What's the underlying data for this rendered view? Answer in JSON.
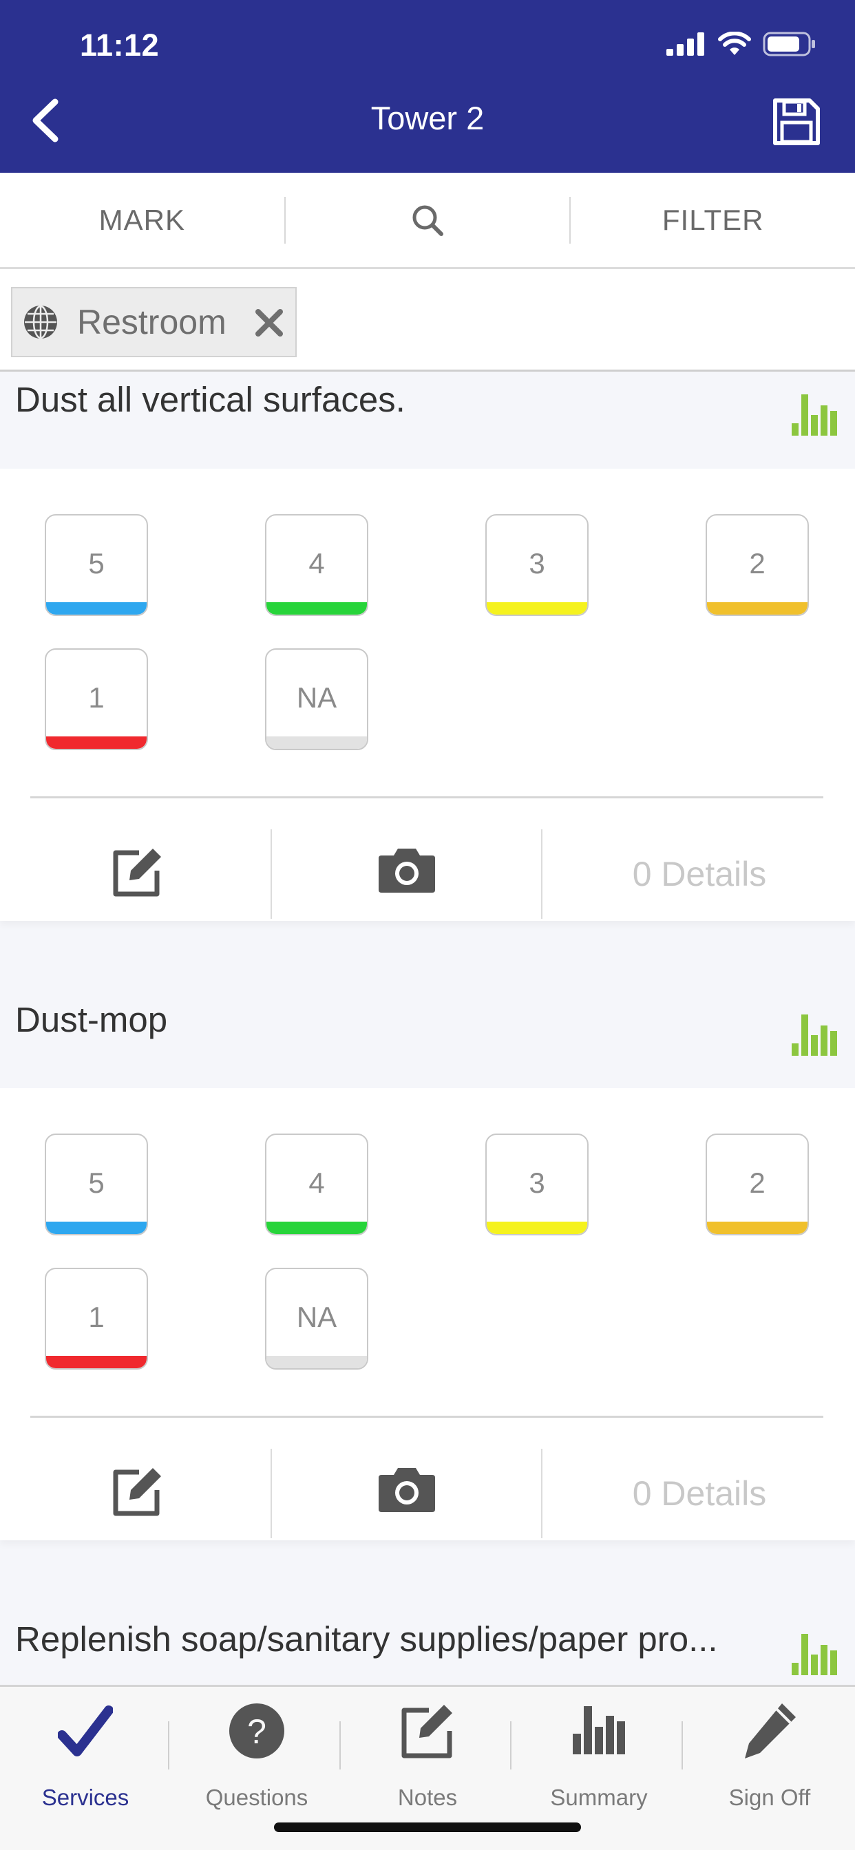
{
  "status_bar": {
    "time": "11:12"
  },
  "header": {
    "title": "Tower 2",
    "back_icon": "chevron-left-icon",
    "save_icon": "floppy-disk-icon"
  },
  "toolbar": {
    "mark_label": "MARK",
    "search_icon": "search-icon",
    "filter_label": "FILTER"
  },
  "filter_chip": {
    "label": "Restroom",
    "icon": "globe-icon",
    "close_icon": "close-icon"
  },
  "rating_scale": [
    {
      "label": "5",
      "color": "#2ea7ef"
    },
    {
      "label": "4",
      "color": "#27d43a"
    },
    {
      "label": "3",
      "color": "#f5f21e"
    },
    {
      "label": "2",
      "color": "#f0c02c"
    },
    {
      "label": "1",
      "color": "#f0292e"
    },
    {
      "label": "NA",
      "color": "#e2e2e2"
    }
  ],
  "tasks": [
    {
      "title": "Dust all vertical surfaces.",
      "details": "0 Details"
    },
    {
      "title": "Dust-mop",
      "details": "0 Details"
    },
    {
      "title": "Replenish soap/sanitary supplies/paper pro..."
    }
  ],
  "tabbar": {
    "tabs": [
      {
        "label": "Services",
        "icon": "checkmark-icon",
        "active": true
      },
      {
        "label": "Questions",
        "icon": "question-circle-icon"
      },
      {
        "label": "Notes",
        "icon": "edit-note-icon"
      },
      {
        "label": "Summary",
        "icon": "bar-chart-icon"
      },
      {
        "label": "Sign Off",
        "icon": "pencil-icon"
      }
    ]
  },
  "colors": {
    "brand": "#2b3190",
    "accent_green": "#8cc63f"
  }
}
